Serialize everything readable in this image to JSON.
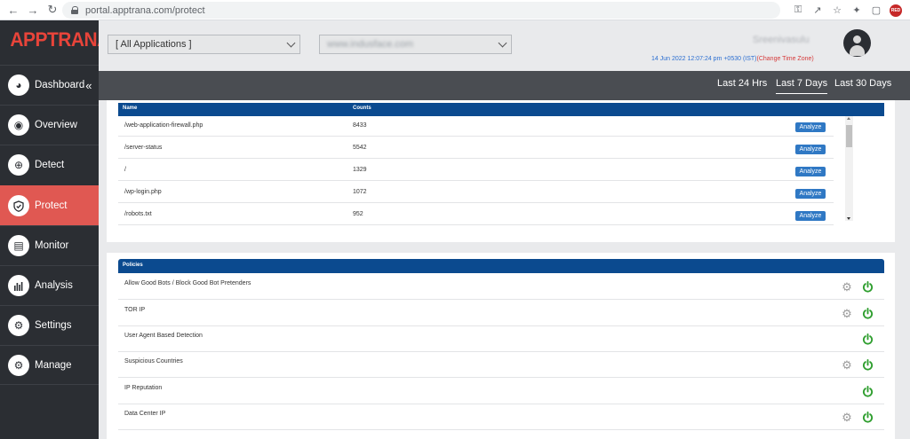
{
  "browser": {
    "url": "portal.apptrana.com/protect"
  },
  "logo": {
    "part1": "APP",
    "part2": "TRANA"
  },
  "sidebar": {
    "items": [
      {
        "label": "Dashboard",
        "icon": "dashboard-icon",
        "active": false
      },
      {
        "label": "Overview",
        "icon": "overview-icon",
        "active": false
      },
      {
        "label": "Detect",
        "icon": "detect-icon",
        "active": false
      },
      {
        "label": "Protect",
        "icon": "shield-icon",
        "active": true
      },
      {
        "label": "Monitor",
        "icon": "monitor-icon",
        "active": false
      },
      {
        "label": "Analysis",
        "icon": "analysis-icon",
        "active": false
      },
      {
        "label": "Settings",
        "icon": "settings-icon",
        "active": false
      },
      {
        "label": "Manage",
        "icon": "manage-icon",
        "active": false
      }
    ],
    "collapse_glyph": "«"
  },
  "header": {
    "app_select": "[ All Applications ]",
    "site_select": "www.indusface.com",
    "username": "Sreenivasulu",
    "datetime": "14 Jun 2022 12:07:24 pm +0530 (IST)",
    "timezone_link": "Change Time Zone"
  },
  "range": {
    "options": [
      "Last 24 Hrs",
      "Last 7 Days",
      "Last 30 Days"
    ],
    "selected": "Last 7 Days"
  },
  "urls_table": {
    "headers": [
      "Name",
      "Counts"
    ],
    "rows": [
      {
        "name": "/web-application-firewall.php",
        "count": "8433",
        "action": "Analyze"
      },
      {
        "name": "/server-status",
        "count": "5542",
        "action": "Analyze"
      },
      {
        "name": "/",
        "count": "1329",
        "action": "Analyze"
      },
      {
        "name": "/wp-login.php",
        "count": "1072",
        "action": "Analyze"
      },
      {
        "name": "/robots.txt",
        "count": "952",
        "action": "Analyze"
      }
    ]
  },
  "policies": {
    "header": "Policies",
    "rows": [
      {
        "label": "Allow Good Bots / Block Good Bot Pretenders",
        "has_settings": true,
        "enabled": true
      },
      {
        "label": "TOR IP",
        "has_settings": true,
        "enabled": true
      },
      {
        "label": "User Agent Based Detection",
        "has_settings": false,
        "enabled": true
      },
      {
        "label": "Suspicious Countries",
        "has_settings": true,
        "enabled": true
      },
      {
        "label": "IP Reputation",
        "has_settings": false,
        "enabled": true
      },
      {
        "label": "Data Center IP",
        "has_settings": true,
        "enabled": true
      }
    ]
  },
  "colors": {
    "sidebar_bg": "#2b2e33",
    "active_item": "#e05852",
    "table_header": "#0b4a8f",
    "analyze_button": "#2f78c4",
    "power_on": "#2e9e2e"
  }
}
